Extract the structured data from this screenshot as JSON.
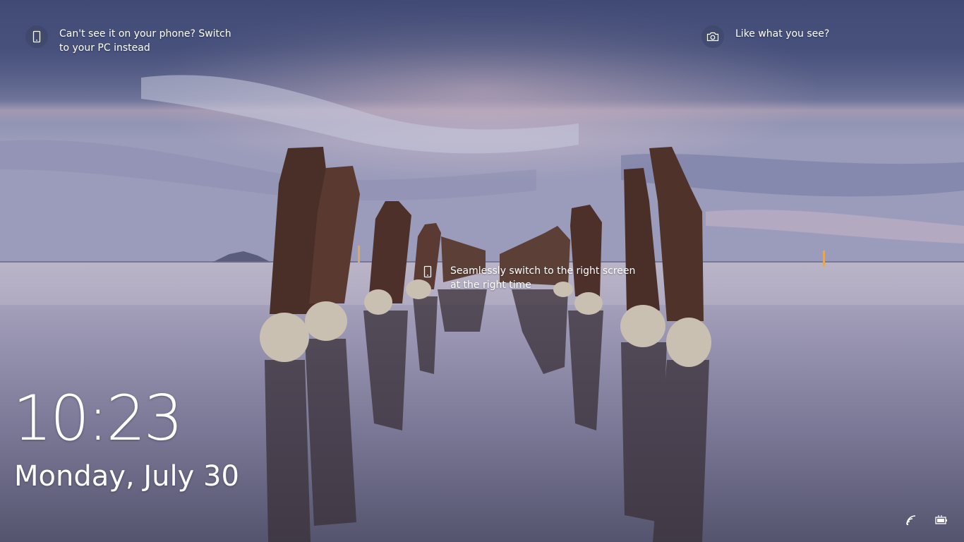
{
  "lockscreen": {
    "hotspots": {
      "phone": {
        "icon": "phone-icon",
        "text": "Can't see it on your phone? Switch to your PC instead"
      },
      "camera": {
        "icon": "camera-icon",
        "text": "Like what you see?"
      },
      "center": {
        "icon": "phone-outline-icon",
        "text": "Seamlessly switch to the right screen at the right time"
      }
    },
    "clock": {
      "time": "10:23",
      "date": "Monday, July 30"
    },
    "tray": {
      "network_icon": "wifi-icon",
      "battery_icon": "battery-icon"
    }
  }
}
